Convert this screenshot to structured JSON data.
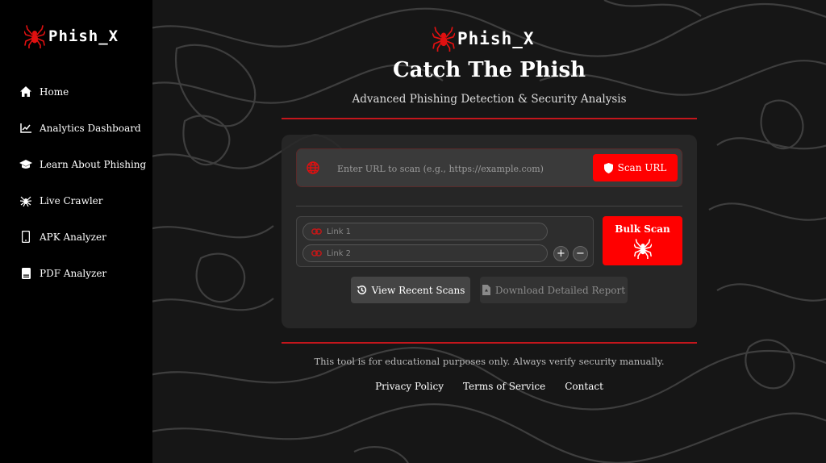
{
  "brand": {
    "name": "Phish_X",
    "accent": "#ff0000",
    "line_color": "#c4161c"
  },
  "sidebar": {
    "items": [
      {
        "label": "Home",
        "icon": "home-icon"
      },
      {
        "label": "Analytics Dashboard",
        "icon": "chart-line-icon"
      },
      {
        "label": "Learn About Phishing",
        "icon": "graduation-cap-icon"
      },
      {
        "label": "Live Crawler",
        "icon": "spider-icon"
      },
      {
        "label": "APK Analyzer",
        "icon": "mobile-icon"
      },
      {
        "label": "PDF Analyzer",
        "icon": "document-icon"
      }
    ],
    "collapse_icon": "chevron-left-icon"
  },
  "header": {
    "title": "Catch The Phish",
    "subtitle": "Advanced Phishing Detection & Security Analysis"
  },
  "scanner": {
    "url_placeholder": "Enter URL to scan (e.g., https://example.com)",
    "url_value": "",
    "scan_button": "Scan URL",
    "bulk": {
      "link1_placeholder": "Link 1",
      "link2_placeholder": "Link 2",
      "add_label": "+",
      "remove_label": "−",
      "button": "Bulk Scan"
    },
    "recent_button": "View Recent Scans",
    "report_button": "Download Detailed Report"
  },
  "footer": {
    "disclaimer": "This tool is for educational purposes only. Always verify security manually.",
    "links": [
      "Privacy Policy",
      "Terms of Service",
      "Contact"
    ]
  }
}
